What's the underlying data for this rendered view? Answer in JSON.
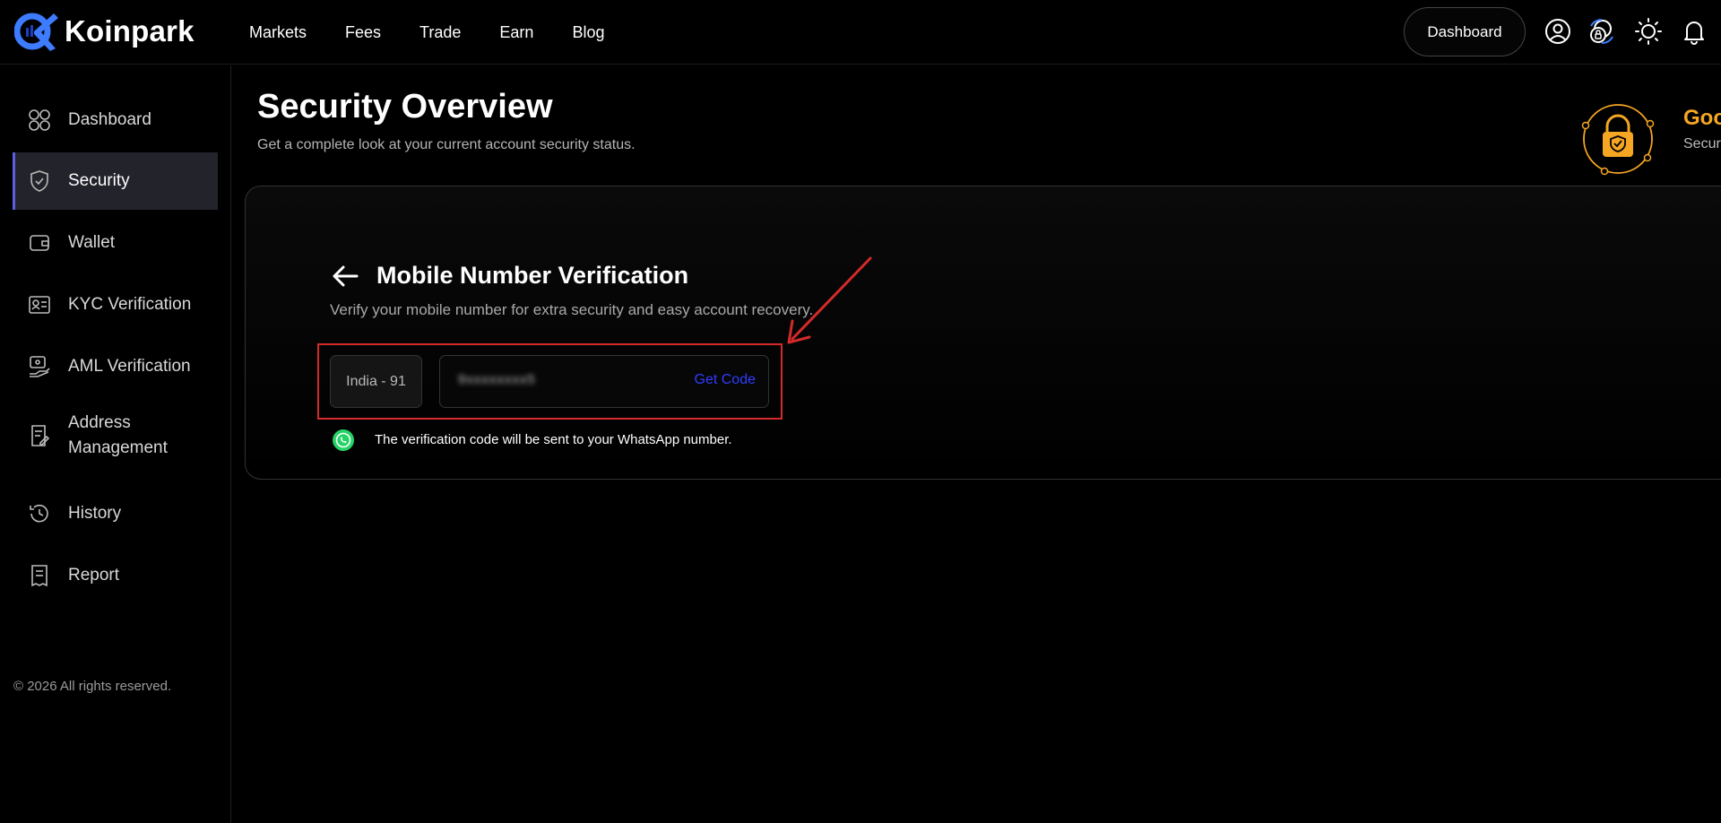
{
  "brand": {
    "name": "Koinpark"
  },
  "nav": {
    "items": [
      {
        "label": "Markets"
      },
      {
        "label": "Fees"
      },
      {
        "label": "Trade"
      },
      {
        "label": "Earn"
      },
      {
        "label": "Blog"
      }
    ]
  },
  "header": {
    "dashboard_button": "Dashboard",
    "icons": [
      "user-icon",
      "security-shield-icon",
      "theme-sun-icon",
      "bell-icon"
    ]
  },
  "sidebar": {
    "items": [
      {
        "label": "Dashboard",
        "icon": "grid-icon",
        "active": false
      },
      {
        "label": "Security",
        "icon": "shield-icon",
        "active": true
      },
      {
        "label": "Wallet",
        "icon": "wallet-icon",
        "active": false
      },
      {
        "label": "KYC Verification",
        "icon": "id-card-icon",
        "active": false
      },
      {
        "label": "AML Verification",
        "icon": "aml-icon",
        "active": false
      },
      {
        "label": "Address Management",
        "icon": "address-book-icon",
        "active": false
      },
      {
        "label": "History",
        "icon": "history-icon",
        "active": false
      },
      {
        "label": "Report",
        "icon": "report-icon",
        "active": false
      }
    ],
    "footer": "© 2026 All rights reserved."
  },
  "page": {
    "title": "Security Overview",
    "subtitle": "Get a complete look at your current account security status.",
    "status_title": "Goo",
    "status_sub": "Secur"
  },
  "verification": {
    "title": "Mobile Number Verification",
    "subtitle": "Verify your mobile number for extra security and easy account recovery.",
    "country_code": "India - 91",
    "phone_value": "9xxxxxxxx5",
    "get_code_label": "Get Code",
    "whatsapp_note": "The verification code will be sent to your WhatsApp number."
  },
  "colors": {
    "accent": "#5b5fe0",
    "link": "#2f3dff",
    "status": "#f5a623",
    "highlight": "#d42a2a",
    "whatsapp": "#25d366"
  }
}
